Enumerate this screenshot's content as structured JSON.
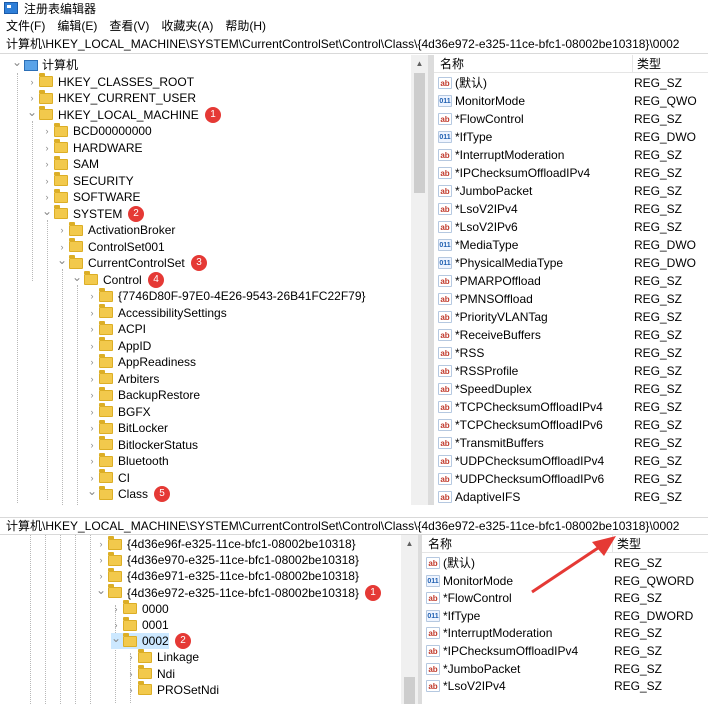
{
  "window": {
    "title": "注册表编辑器"
  },
  "menu": [
    "文件(F)",
    "编辑(E)",
    "查看(V)",
    "收藏夹(A)",
    "帮助(H)"
  ],
  "address_top": "计算机\\HKEY_LOCAL_MACHINE\\SYSTEM\\CurrentControlSet\\Control\\Class\\{4d36e972-e325-11ce-bfc1-08002be10318}\\0002",
  "address_bottom": "计算机\\HKEY_LOCAL_MACHINE\\SYSTEM\\CurrentControlSet\\Control\\Class\\{4d36e972-e325-11ce-bfc1-08002be10318}\\0002",
  "list_headers": {
    "name": "名称",
    "type": "类型"
  },
  "top_tree": [
    {
      "label": "计算机",
      "level": 0,
      "expanded": true,
      "root": true
    },
    {
      "label": "HKEY_CLASSES_ROOT",
      "level": 1
    },
    {
      "label": "HKEY_CURRENT_USER",
      "level": 1
    },
    {
      "label": "HKEY_LOCAL_MACHINE",
      "level": 1,
      "expanded": true,
      "badge": "1"
    },
    {
      "label": "BCD00000000",
      "level": 2
    },
    {
      "label": "HARDWARE",
      "level": 2
    },
    {
      "label": "SAM",
      "level": 2
    },
    {
      "label": "SECURITY",
      "level": 2
    },
    {
      "label": "SOFTWARE",
      "level": 2
    },
    {
      "label": "SYSTEM",
      "level": 2,
      "expanded": true,
      "badge": "2"
    },
    {
      "label": "ActivationBroker",
      "level": 3
    },
    {
      "label": "ControlSet001",
      "level": 3
    },
    {
      "label": "CurrentControlSet",
      "level": 3,
      "expanded": true,
      "badge": "3"
    },
    {
      "label": "Control",
      "level": 4,
      "expanded": true,
      "badge": "4"
    },
    {
      "label": "{7746D80F-97E0-4E26-9543-26B41FC22F79}",
      "level": 5
    },
    {
      "label": "AccessibilitySettings",
      "level": 5
    },
    {
      "label": "ACPI",
      "level": 5
    },
    {
      "label": "AppID",
      "level": 5
    },
    {
      "label": "AppReadiness",
      "level": 5
    },
    {
      "label": "Arbiters",
      "level": 5
    },
    {
      "label": "BackupRestore",
      "level": 5
    },
    {
      "label": "BGFX",
      "level": 5
    },
    {
      "label": "BitLocker",
      "level": 5
    },
    {
      "label": "BitlockerStatus",
      "level": 5
    },
    {
      "label": "Bluetooth",
      "level": 5
    },
    {
      "label": "CI",
      "level": 5
    },
    {
      "label": "Class",
      "level": 5,
      "expanded": true,
      "badge": "5"
    }
  ],
  "top_values": [
    {
      "icon": "ab",
      "name": "(默认)",
      "type": "REG_SZ"
    },
    {
      "icon": "bin",
      "name": "MonitorMode",
      "type": "REG_QWO"
    },
    {
      "icon": "ab",
      "name": "*FlowControl",
      "type": "REG_SZ"
    },
    {
      "icon": "bin",
      "name": "*IfType",
      "type": "REG_DWO"
    },
    {
      "icon": "ab",
      "name": "*InterruptModeration",
      "type": "REG_SZ"
    },
    {
      "icon": "ab",
      "name": "*IPChecksumOffloadIPv4",
      "type": "REG_SZ"
    },
    {
      "icon": "ab",
      "name": "*JumboPacket",
      "type": "REG_SZ"
    },
    {
      "icon": "ab",
      "name": "*LsoV2IPv4",
      "type": "REG_SZ"
    },
    {
      "icon": "ab",
      "name": "*LsoV2IPv6",
      "type": "REG_SZ"
    },
    {
      "icon": "bin",
      "name": "*MediaType",
      "type": "REG_DWO"
    },
    {
      "icon": "bin",
      "name": "*PhysicalMediaType",
      "type": "REG_DWO"
    },
    {
      "icon": "ab",
      "name": "*PMARPOffload",
      "type": "REG_SZ"
    },
    {
      "icon": "ab",
      "name": "*PMNSOffload",
      "type": "REG_SZ"
    },
    {
      "icon": "ab",
      "name": "*PriorityVLANTag",
      "type": "REG_SZ"
    },
    {
      "icon": "ab",
      "name": "*ReceiveBuffers",
      "type": "REG_SZ"
    },
    {
      "icon": "ab",
      "name": "*RSS",
      "type": "REG_SZ"
    },
    {
      "icon": "ab",
      "name": "*RSSProfile",
      "type": "REG_SZ"
    },
    {
      "icon": "ab",
      "name": "*SpeedDuplex",
      "type": "REG_SZ"
    },
    {
      "icon": "ab",
      "name": "*TCPChecksumOffloadIPv4",
      "type": "REG_SZ"
    },
    {
      "icon": "ab",
      "name": "*TCPChecksumOffloadIPv6",
      "type": "REG_SZ"
    },
    {
      "icon": "ab",
      "name": "*TransmitBuffers",
      "type": "REG_SZ"
    },
    {
      "icon": "ab",
      "name": "*UDPChecksumOffloadIPv4",
      "type": "REG_SZ"
    },
    {
      "icon": "ab",
      "name": "*UDPChecksumOffloadIPv6",
      "type": "REG_SZ"
    },
    {
      "icon": "ab",
      "name": "AdaptiveIFS",
      "type": "REG_SZ"
    }
  ],
  "bottom_tree": [
    {
      "label": "{4d36e96f-e325-11ce-bfc1-08002be10318}",
      "level": 0
    },
    {
      "label": "{4d36e970-e325-11ce-bfc1-08002be10318}",
      "level": 0
    },
    {
      "label": "{4d36e971-e325-11ce-bfc1-08002be10318}",
      "level": 0
    },
    {
      "label": "{4d36e972-e325-11ce-bfc1-08002be10318}",
      "level": 0,
      "expanded": true,
      "badge": "1"
    },
    {
      "label": "0000",
      "level": 1
    },
    {
      "label": "0001",
      "level": 1
    },
    {
      "label": "0002",
      "level": 1,
      "expanded": true,
      "selected": true,
      "badge": "2"
    },
    {
      "label": "Linkage",
      "level": 2
    },
    {
      "label": "Ndi",
      "level": 2
    },
    {
      "label": "PROSetNdi",
      "level": 2
    }
  ],
  "bottom_values": [
    {
      "icon": "ab",
      "name": "(默认)",
      "type": "REG_SZ"
    },
    {
      "icon": "bin",
      "name": "MonitorMode",
      "type": "REG_QWORD"
    },
    {
      "icon": "ab",
      "name": "*FlowControl",
      "type": "REG_SZ"
    },
    {
      "icon": "bin",
      "name": "*IfType",
      "type": "REG_DWORD"
    },
    {
      "icon": "ab",
      "name": "*InterruptModeration",
      "type": "REG_SZ"
    },
    {
      "icon": "ab",
      "name": "*IPChecksumOffloadIPv4",
      "type": "REG_SZ"
    },
    {
      "icon": "ab",
      "name": "*JumboPacket",
      "type": "REG_SZ"
    },
    {
      "icon": "ab",
      "name": "*LsoV2IPv4",
      "type": "REG_SZ"
    }
  ],
  "colors": {
    "badge": "#e53935",
    "arrow": "#e53935",
    "selection": "#cce8ff"
  }
}
